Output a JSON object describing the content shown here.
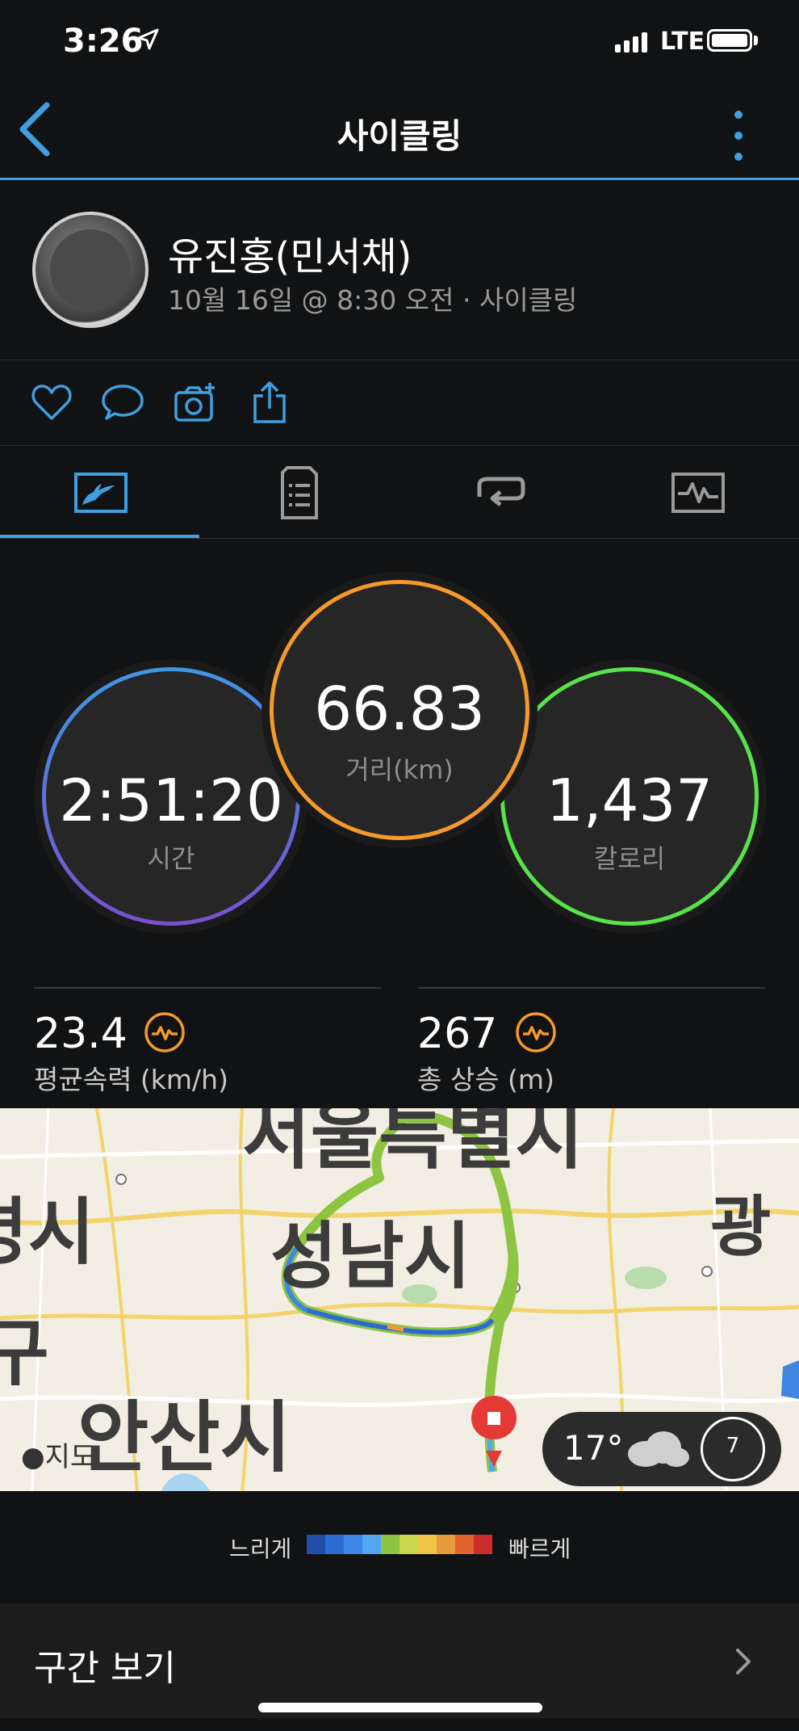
{
  "status_bar": {
    "time": "3:26",
    "network": "LTE"
  },
  "nav": {
    "title": "사이클링"
  },
  "profile": {
    "name": "유진홍(민서채)",
    "meta": "10월 16일 @ 8:30 오전 · 사이클링"
  },
  "actions": [
    "heart-icon",
    "comment-icon",
    "camera-add-icon",
    "share-icon"
  ],
  "tabs": [
    "summary-tab",
    "details-tab",
    "laps-tab",
    "charts-tab"
  ],
  "stats": {
    "time": {
      "value": "2:51:20",
      "label": "시간"
    },
    "distance": {
      "value": "66.83",
      "label": "거리(km)"
    },
    "calories": {
      "value": "1,437",
      "label": "칼로리"
    },
    "avg_speed": {
      "value": "23.4",
      "label": "평균속력 (km/h)"
    },
    "total_ascent": {
      "value": "267",
      "label": "총 상승 (m)"
    }
  },
  "map": {
    "cities": [
      "서울특별시",
      "성남시",
      "광",
      "명시",
      "구",
      "안산시"
    ],
    "logo": "지도",
    "weather": {
      "temp": "17°",
      "wind": "7"
    }
  },
  "legend": {
    "slow": "느리게",
    "fast": "빠르게",
    "colors": [
      "#1f4fa8",
      "#2c6cd0",
      "#3d86e6",
      "#53a6ef",
      "#8dc542",
      "#c9d54a",
      "#efc345",
      "#ea9a3c",
      "#e0622f",
      "#cc2d2d"
    ]
  },
  "laps": {
    "label": "구간 보기"
  },
  "colors": {
    "accent": "#3f9fe0",
    "distance_ring": "#f39a2a",
    "calorie_ring": "#57e34a"
  }
}
